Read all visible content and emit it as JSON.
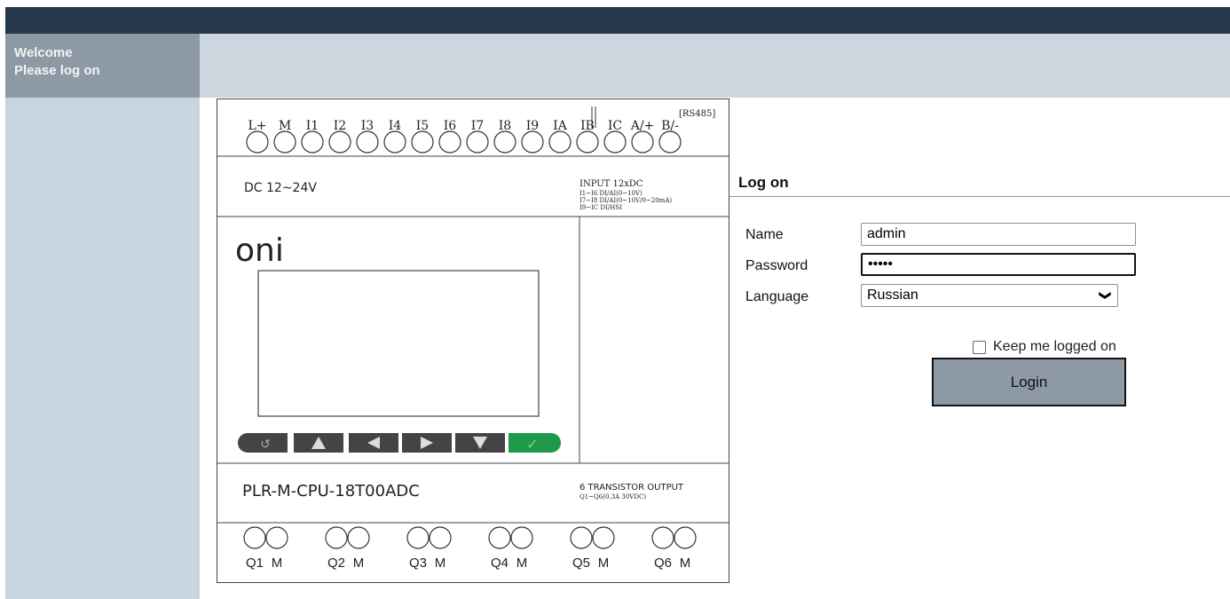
{
  "sidebar": {
    "welcome": "Welcome",
    "prompt": "Please log on"
  },
  "device": {
    "top_terminals": [
      "L+",
      "M",
      "I1",
      "I2",
      "I3",
      "I4",
      "I5",
      "I6",
      "I7",
      "I8",
      "I9",
      "IA",
      "IB",
      "IC",
      "A/+",
      "B/-"
    ],
    "rs485_label": "[RS485]",
    "power_label": "DC 12~24V",
    "input_title": "INPUT 12xDC",
    "input_lines": [
      "I1~I6 DI/AI(0~10V)",
      "I7~I8 DI/AI(0~10V/0~20mA)",
      "I9~IC DI/HSI"
    ],
    "brand": "oni",
    "model": "PLR-M-CPU-18T00ADC",
    "output_title": "6 TRANSISTOR OUTPUT",
    "output_line": "Q1~Q6(0.3A 30VDC)",
    "bottom_terminals": [
      "Q1",
      "M",
      "Q2",
      "M",
      "Q3",
      "M",
      "Q4",
      "M",
      "Q5",
      "M",
      "Q6",
      "M"
    ],
    "keys": [
      "back-icon",
      "up-arrow-icon",
      "left-arrow-icon",
      "right-arrow-icon",
      "down-arrow-icon",
      "check-icon"
    ]
  },
  "login": {
    "title": "Log on",
    "name_label": "Name",
    "name_value": "admin",
    "password_label": "Password",
    "password_value": "•••••",
    "language_label": "Language",
    "language_value": "Russian",
    "keep_label": "Keep me logged on",
    "keep_checked": false,
    "button_label": "Login"
  },
  "colors": {
    "header": "#26384a",
    "sidebar": "#c8d4de",
    "welcome_box": "#8d99a4",
    "button": "#8d99a4",
    "ok_key": "#1e9a4a"
  }
}
